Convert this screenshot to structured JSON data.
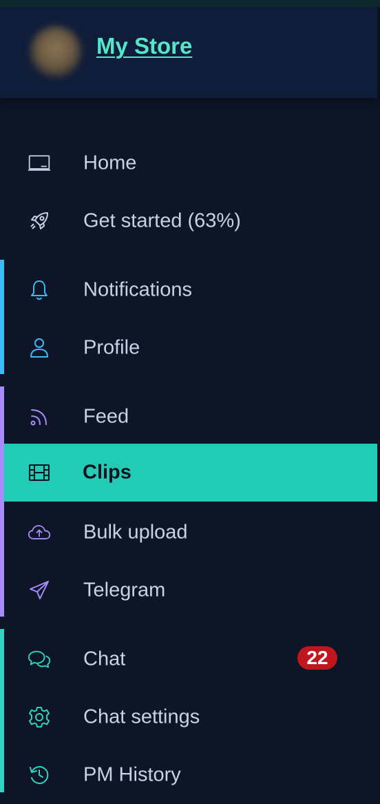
{
  "store": {
    "name": "My Store"
  },
  "nav": {
    "items": [
      {
        "label": "Home",
        "icon": "laptop-icon"
      },
      {
        "label": "Get started (63%)",
        "icon": "rocket-icon"
      },
      {
        "label": "Notifications",
        "icon": "bell-icon"
      },
      {
        "label": "Profile",
        "icon": "user-icon"
      },
      {
        "label": "Feed",
        "icon": "rss-icon"
      },
      {
        "label": "Clips",
        "icon": "film-icon",
        "active": true
      },
      {
        "label": "Bulk upload",
        "icon": "cloud-upload-icon"
      },
      {
        "label": "Telegram",
        "icon": "send-icon"
      },
      {
        "label": "Chat",
        "icon": "chat-bubbles-icon",
        "badge": "22"
      },
      {
        "label": "Chat settings",
        "icon": "gear-icon"
      },
      {
        "label": "PM History",
        "icon": "history-icon"
      }
    ]
  },
  "colors": {
    "background": "#0d1526",
    "header": "#0f1d3a",
    "accent": "#22ccb4",
    "store_name": "#54e6c8",
    "group_blue": "#38bdf8",
    "group_purple": "#a78bfa",
    "group_teal": "#2dd4bf",
    "badge": "#c0161e"
  }
}
